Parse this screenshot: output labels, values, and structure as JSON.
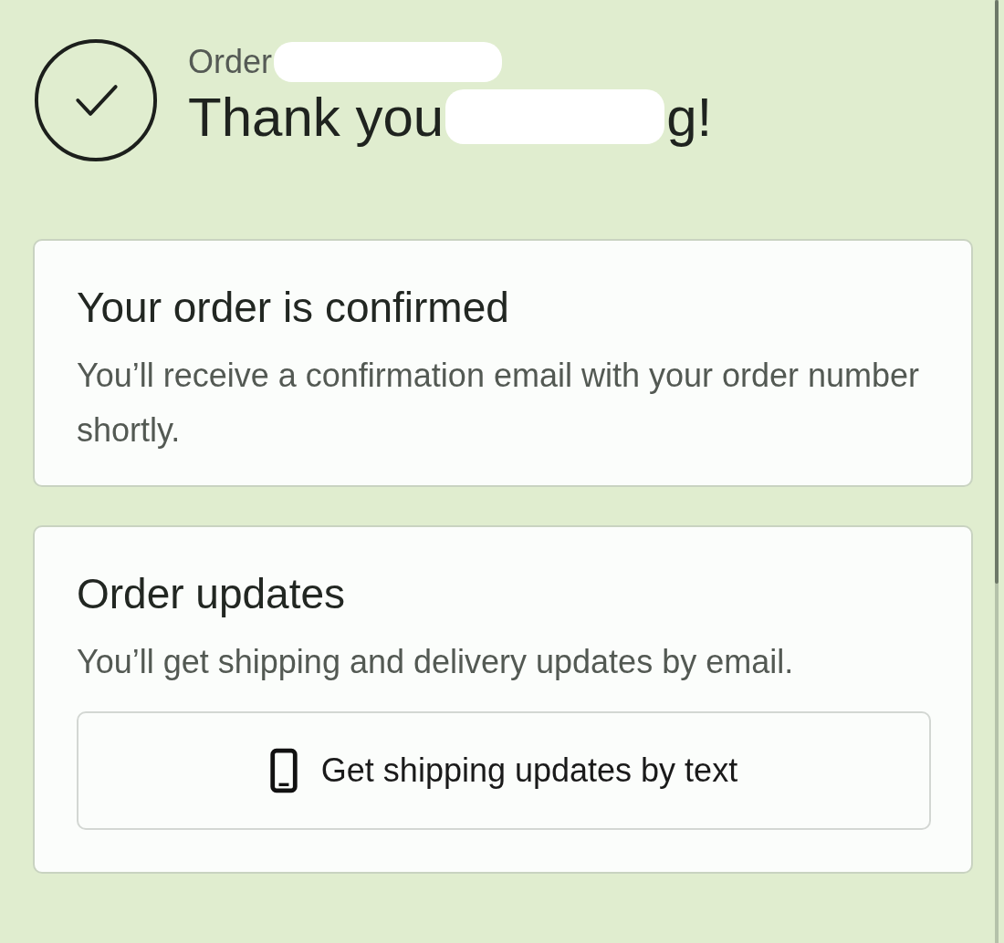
{
  "header": {
    "order_label": "Order",
    "title": "Thank you",
    "title_end": "g!"
  },
  "cards": [
    {
      "kind": "info",
      "heading": "Your order is confirmed",
      "text": "You’ll receive a confirmation email with your order number shortly."
    },
    {
      "kind": "updates",
      "heading": "Order updates",
      "text": "You’ll get shipping and delivery updates by email.",
      "button": "Get shipping updates by text"
    }
  ]
}
